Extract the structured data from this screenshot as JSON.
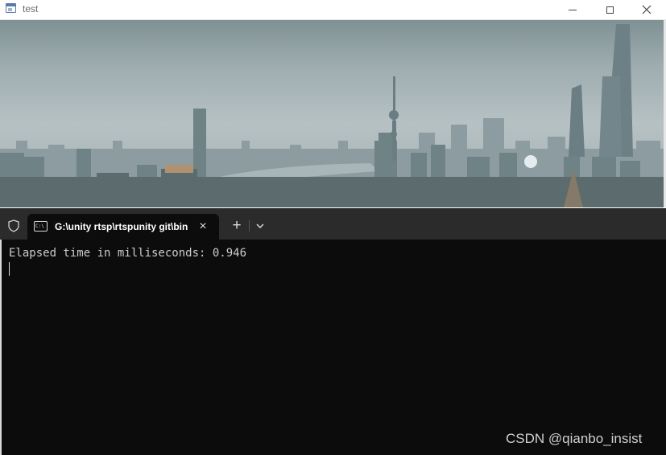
{
  "window": {
    "title": "test",
    "icon": "app-window-icon",
    "controls": [
      "minimize-icon",
      "maximize-icon",
      "close-icon"
    ]
  },
  "video": {
    "description_icon": "city-skyline-image"
  },
  "terminal": {
    "shield_icon": "shield-icon",
    "tab": {
      "icon": "cmd-icon",
      "icon_text": "C:\\",
      "title": "G:\\unity rtsp\\rtspunity git\\bin"
    },
    "close_tab_icon": "×",
    "new_tab_icon": "+",
    "output_line": "Elapsed time in milliseconds: 0.946"
  },
  "watermark": "CSDN @qianbo_insist",
  "colors": {
    "terminal_bg": "#0c0c0c",
    "tabbar_bg": "#2b2b2b",
    "terminal_text": "#cccccc"
  }
}
